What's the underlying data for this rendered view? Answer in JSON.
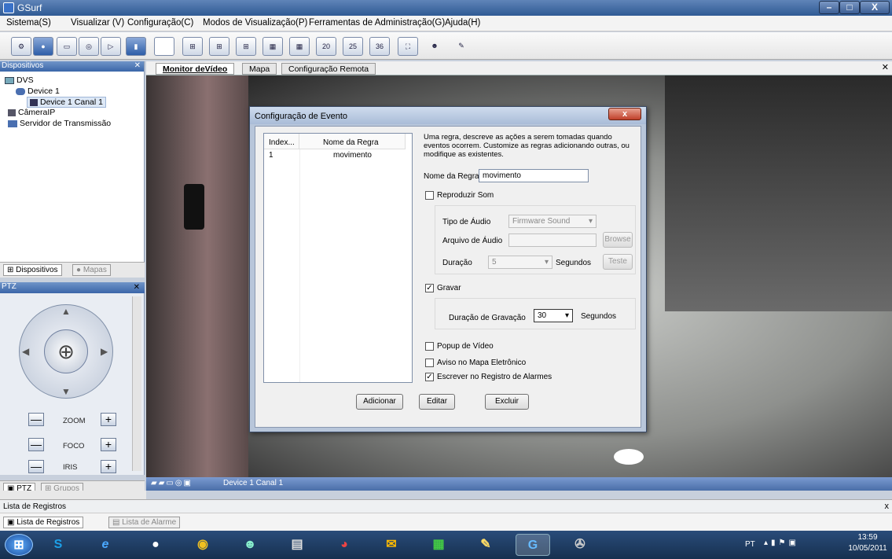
{
  "window": {
    "title": "GSurf",
    "min": "–",
    "max": "□",
    "close": "X"
  },
  "menu": [
    "Sistema(S)",
    "Visualizar (V)",
    "Configuração(C)",
    "Modos de Visualização(P)",
    "Ferramentas de Administração(G)",
    "Ajuda(H)"
  ],
  "toolbar": {
    "grid_labels": [
      "20",
      "25",
      "36"
    ]
  },
  "devices": {
    "header": "Dispositivos",
    "root": "DVS",
    "device": "Device 1",
    "channel": "Device 1 Canal 1",
    "camera": "CâmeraIP",
    "server": "Servidor de Transmissão",
    "tab_devices": "Dispositivos",
    "tab_maps": "Mapas"
  },
  "ptz": {
    "header": "PTZ",
    "zoom": "ZOOM",
    "focus": "FOCO",
    "iris": "IRIS",
    "minus": "—",
    "plus": "+",
    "tab_ptz": "PTZ",
    "tab_groups": "Grupos"
  },
  "video": {
    "tabs": [
      "Monitor deVídeo",
      "Mapa",
      "Configuração Remota"
    ],
    "status": "Device 1 Canal 1"
  },
  "dialog": {
    "title": "Configuração de Evento",
    "close": "x",
    "col_index": "Index...",
    "col_name": "Nome da Regra",
    "rows": [
      {
        "index": "1",
        "name": "movimento"
      }
    ],
    "description": "Uma regra, descreve as ações a serem tomadas quando eventos ocorrem. Customize as regras adicionando outras, ou modifique as existentes.",
    "rule_name_label": "Nome da Regra:",
    "rule_name_value": "movimento",
    "play_sound": "Reproduzir Som",
    "audio_type_label": "Tipo de Áudio",
    "audio_type_value": "Firmware Sound",
    "audio_file_label": "Arquivo de Áudio",
    "browse": "Browse",
    "duration_label": "Duração",
    "duration_value": "5",
    "seconds": "Segundos",
    "test": "Teste",
    "record": "Gravar",
    "record_duration_label": "Duração de Gravação",
    "record_duration_value": "30",
    "record_seconds": "Segundos",
    "popup": "Popup de Vídeo",
    "emap": "Aviso no Mapa Eletrônico",
    "alarm_log": "Escrever no Registro de Alarmes",
    "add": "Adicionar",
    "edit": "Editar",
    "delete": "Excluir"
  },
  "logs": {
    "header": "Lista de Registros",
    "tab_logs": "Lista de Registros",
    "tab_alarms": "Lista de Alarme",
    "close": "x"
  },
  "taskbar": {
    "lang": "PT",
    "time": "13:59",
    "date": "10/05/2011"
  },
  "colors": {
    "accent": "#3b66a8",
    "title_bar": "#2f5a94",
    "taskbar": "#16304f"
  }
}
